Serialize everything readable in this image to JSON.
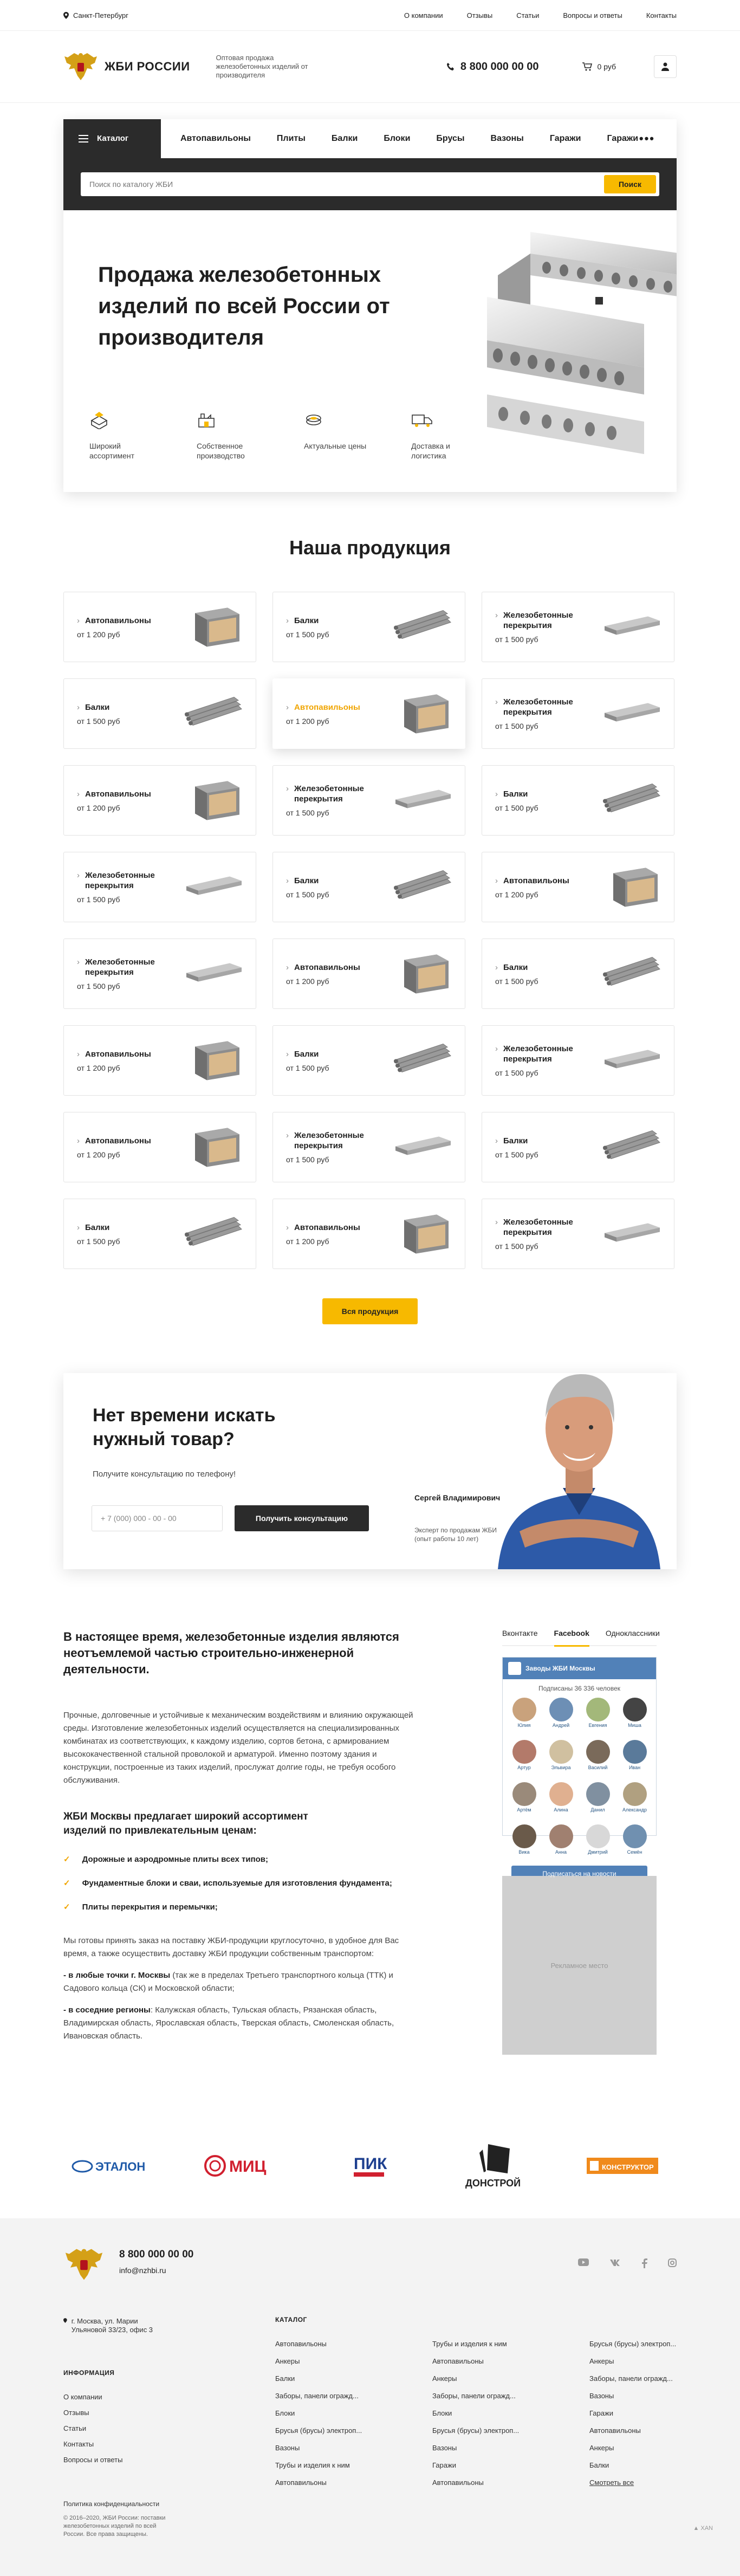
{
  "topbar": {
    "city": "Санкт-Петербург",
    "links": [
      "О компании",
      "Отзывы",
      "Статьи",
      "Вопросы и ответы",
      "Контакты"
    ]
  },
  "header": {
    "brand": "ЖБИ РОССИИ",
    "tagline": "Оптовая продажа железобетонных изделий от производителя",
    "phone": "8 800 000 00 00",
    "cart": "0 руб"
  },
  "menu": {
    "catalog": "Каталог",
    "items": [
      "Автопавильоны",
      "Плиты",
      "Балки",
      "Блоки",
      "Брусы",
      "Вазоны",
      "Гаражи",
      "Гаражи"
    ],
    "more": "•••"
  },
  "search": {
    "placeholder": "Поиск по каталогу ЖБИ",
    "button": "Поиск"
  },
  "hero": {
    "title": "Продажа железобетонных изделий по всей России от производителя",
    "features": [
      "Широкий ассортимент",
      "Собственное производство",
      "Актуальные цены",
      "Доставка и логистика"
    ]
  },
  "products": {
    "title": "Наша продукция",
    "button": "Вся продукция",
    "cards": [
      {
        "name": "Автопавильоны",
        "price": "от 1 200 руб",
        "img": "pavilion"
      },
      {
        "name": "Балки",
        "price": "от 1 500 руб",
        "img": "pipes"
      },
      {
        "name": "Железобетонные перекрытия",
        "price": "от 1 500 руб",
        "img": "slab"
      },
      {
        "name": "Балки",
        "price": "от 1 500 руб",
        "img": "pipes"
      },
      {
        "name": "Автопавильоны",
        "price": "от 1 200 руб",
        "img": "pavilion",
        "active": true
      },
      {
        "name": "Железобетонные перекрытия",
        "price": "от 1 500 руб",
        "img": "slab"
      },
      {
        "name": "Автопавильоны",
        "price": "от 1 200 руб",
        "img": "pavilion"
      },
      {
        "name": "Железобетонные перекрытия",
        "price": "от 1 500 руб",
        "img": "slab"
      },
      {
        "name": "Балки",
        "price": "от 1 500 руб",
        "img": "pipes"
      },
      {
        "name": "Железобетонные перекрытия",
        "price": "от 1 500 руб",
        "img": "slab"
      },
      {
        "name": "Балки",
        "price": "от 1 500 руб",
        "img": "pipes"
      },
      {
        "name": "Автопавильоны",
        "price": "от 1 200 руб",
        "img": "pavilion"
      },
      {
        "name": "Железобетонные перекрытия",
        "price": "от 1 500 руб",
        "img": "slab"
      },
      {
        "name": "Автопавильоны",
        "price": "от 1 200 руб",
        "img": "pavilion"
      },
      {
        "name": "Балки",
        "price": "от 1 500 руб",
        "img": "pipes"
      },
      {
        "name": "Автопавильоны",
        "price": "от 1 200 руб",
        "img": "pavilion"
      },
      {
        "name": "Балки",
        "price": "от 1 500 руб",
        "img": "pipes"
      },
      {
        "name": "Железобетонные перекрытия",
        "price": "от 1 500 руб",
        "img": "slab"
      },
      {
        "name": "Автопавильоны",
        "price": "от 1 200 руб",
        "img": "pavilion"
      },
      {
        "name": "Железобетонные перекрытия",
        "price": "от 1 500 руб",
        "img": "slab"
      },
      {
        "name": "Балки",
        "price": "от 1 500 руб",
        "img": "pipes"
      },
      {
        "name": "Балки",
        "price": "от 1 500 руб",
        "img": "pipes"
      },
      {
        "name": "Автопавильоны",
        "price": "от 1 200 руб",
        "img": "pavilion"
      },
      {
        "name": "Железобетонные перекрытия",
        "price": "от 1 500 руб",
        "img": "slab"
      }
    ]
  },
  "consult": {
    "title": "Нет времени искать нужный товар?",
    "subtitle": "Получите консультацию по телефону!",
    "phone_placeholder": "+ 7 (000) 000 - 00 - 00",
    "button": "Получить консультацию",
    "expert_name": "Сергей Владимирович",
    "expert_role": "Эксперт по продажам ЖБИ (опыт работы 10 лет)"
  },
  "content": {
    "heading": "В настоящее время, железобетонные изделия являются неотъемлемой частью строительно-инженерной деятельности.",
    "p1": "Прочные, долговечные и устойчивые к механическим воздействиям и влиянию окружающей среды. Изготовление железобетонных изделий осуществляется на специализированных комбинатах из соответствующих, к каждому изделию, сортов бетона, с армированием высококачественной стальной проволокой и арматурой. Именно поэтому здания и конструкции, построенные из таких изделий, прослужат долгие годы, не требуя особого обслуживания.",
    "subheading": "ЖБИ Москвы предлагает широкий ассортимент изделий по привлекательным ценам:",
    "list": [
      "Дорожные и аэродромные плиты всех типов;",
      "Фундаментные блоки и сваи, используемые для изготовления фундамента;",
      "Плиты перекрытия и перемычки;"
    ],
    "p2": "Мы готовы принять заказ на поставку ЖБИ-продукции круглосуточно, в удобное для Вас время, а также осуществить доставку ЖБИ продукции собственным транспортом:",
    "p3_bold": "- в любые точки г. Москвы",
    "p3": " (так же в пределах Третьего транспортного кольца (ТТК) и Садового кольца (СК) и Московской области;",
    "p4_bold": "- в соседние регионы",
    "p4": ": Калужская область, Тульская область, Рязанская область, Владимирская область, Ярославская область, Тверская область, Смоленская область, Ивановская область."
  },
  "social": {
    "tabs": [
      "Вконтакте",
      "Facebook",
      "Одноклассники"
    ],
    "group": "Заводы ЖБИ Москвы",
    "subscribers": "Подписаны 36 336 человек",
    "names": [
      "Юлия",
      "Андрей",
      "Евгения",
      "Миша",
      "Артур",
      "Эльвира",
      "Василий",
      "Иван",
      "Артём",
      "Алина",
      "Данил",
      "Александр",
      "Вика",
      "Анна",
      "Дмитрий",
      "Семён"
    ],
    "join": "Подписаться на новости",
    "banner": "Рекламное место"
  },
  "partners": [
    "ЭТАЛОН",
    "МИЦ",
    "ПИК",
    "ДОНСТРОЙ",
    "КОНСТРУКТОР"
  ],
  "footer": {
    "phone": "8 800 000 00 00",
    "email": "info@nzhbi.ru",
    "address": "г. Москва, ул. Марии Ульяновой 33/23, офис 3",
    "info_head": "ИНФОРМАЦИЯ",
    "info_links": [
      "О компании",
      "Отзывы",
      "Статьи",
      "Контакты",
      "Вопросы и ответы"
    ],
    "catalog_head": "КАТАЛОГ",
    "catalog": [
      "Автопавильоны",
      "Трубы и изделия к ним",
      "Брусья (брусы) электроп...",
      "Анкеры",
      "Автопавильоны",
      "Анкеры",
      "Балки",
      "Анкеры",
      "Заборы, панели огражд...",
      "Заборы, панели огражд...",
      "Заборы, панели огражд...",
      "Вазоны",
      "Блоки",
      "Блоки",
      "Гаражи",
      "Брусья (брусы) электроп...",
      "Брусья (брусы) электроп...",
      "Автопавильоны",
      "Вазоны",
      "Вазоны",
      "Анкеры",
      "Трубы и изделия к ним",
      "Гаражи",
      "Балки",
      "Автопавильоны",
      "Автопавильоны",
      "Смотреть все"
    ],
    "policy": "Политика конфиденциальности",
    "copyright": "© 2016–2020, ЖБИ России: поставки железобетонных изделий по всей России. Все права защищены.",
    "dev": "▲ XAN"
  },
  "colors": {
    "accent": "#f7b900",
    "dark": "#2b2b2b"
  }
}
